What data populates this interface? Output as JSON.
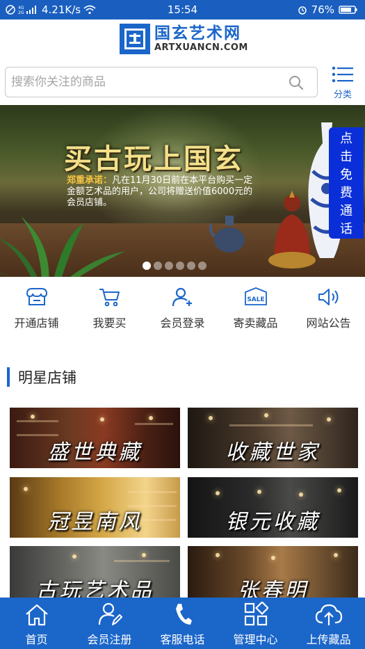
{
  "status_bar": {
    "network": "4.21K/s",
    "time": "15:54",
    "battery": "76%",
    "icons": [
      "no-sim-icon",
      "signal-icon",
      "wifi-icon",
      "alarm-icon",
      "battery-icon"
    ]
  },
  "header": {
    "logo_cn": "国玄艺术网",
    "logo_en": "ARTXUANCN.COM"
  },
  "search": {
    "placeholder": "搜索你关注的商品",
    "category_label": "分类"
  },
  "banner": {
    "title": "买古玩上国玄",
    "promise_emphasis": "郑重承诺：",
    "promise_text": "凡在11月30日前在本平台购买一定金额艺术品的用户，公司将赠送价值6000元的会员店铺。",
    "call_label": [
      "点",
      "击",
      "免",
      "费",
      "通",
      "话"
    ],
    "slide_count": 6,
    "active_slide": 1
  },
  "quick_nav": [
    {
      "label": "开通店铺",
      "icon": "shop-icon"
    },
    {
      "label": "我要买",
      "icon": "cart-icon"
    },
    {
      "label": "会员登录",
      "icon": "user-add-icon"
    },
    {
      "label": "寄卖藏品",
      "icon": "sale-tag-icon"
    },
    {
      "label": "网站公告",
      "icon": "speaker-icon"
    }
  ],
  "section": {
    "title": "明星店铺"
  },
  "stores": [
    {
      "name": "盛世典藏"
    },
    {
      "name": "收藏世家"
    },
    {
      "name": "冠昱南风"
    },
    {
      "name": "银元收藏"
    },
    {
      "name": "古玩艺术品"
    },
    {
      "name": "张春明"
    }
  ],
  "bottom_nav": [
    {
      "label": "首页",
      "icon": "home-icon"
    },
    {
      "label": "会员注册",
      "icon": "user-edit-icon"
    },
    {
      "label": "客服电话",
      "icon": "phone-icon"
    },
    {
      "label": "管理中心",
      "icon": "grid-icon"
    },
    {
      "label": "上传藏品",
      "icon": "cloud-upload-icon"
    }
  ],
  "colors": {
    "brand_blue": "#1b66c9",
    "call_button": "#0a2fd8",
    "banner_title": "#f3e08a",
    "promise_emphasis": "#f6c343"
  }
}
